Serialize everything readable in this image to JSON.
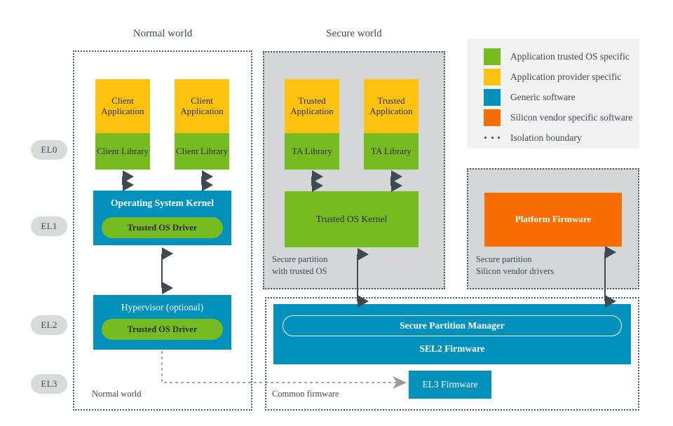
{
  "worlds": {
    "normal_title": "Normal world",
    "secure_title": "Secure world"
  },
  "exception_levels": [
    {
      "label": "EL0"
    },
    {
      "label": "EL1"
    },
    {
      "label": "EL2"
    },
    {
      "label": "EL3"
    }
  ],
  "normal_world": {
    "footer_label": "Normal world",
    "stacks": [
      {
        "app": "Client\nApplication",
        "lib": "Client\nLibrary"
      },
      {
        "app": "Client\nApplication",
        "lib": "Client\nLibrary"
      }
    ],
    "kernel": {
      "title": "Operating System Kernel",
      "driver": "Trusted OS Driver"
    },
    "hypervisor": {
      "title": "Hypervisor (optional)",
      "driver": "Trusted OS Driver"
    }
  },
  "secure_world": {
    "partition_caption": "Secure partition\nwith trusted OS",
    "stacks": [
      {
        "app": "Trusted\nApplication",
        "lib": "TA Library"
      },
      {
        "app": "Trusted\nApplication",
        "lib": "TA Library"
      }
    ],
    "kernel": "Trusted OS Kernel"
  },
  "vendor_partition": {
    "caption": "Secure partition\nSilicon vendor drivers",
    "firmware": "Platform Firmware"
  },
  "common_firmware": {
    "footer_label": "Common firmware",
    "spm": "Secure Partition Manager",
    "sel2": "SEL2 Firmware",
    "el3": "EL3 Firmware"
  },
  "legend": {
    "items": [
      {
        "type": "swatch",
        "color": "#76BC21",
        "label": "Application trusted OS specific"
      },
      {
        "type": "swatch",
        "color": "#FFC20E",
        "label": "Application provider specific"
      },
      {
        "type": "swatch",
        "color": "#0091BD",
        "label": "Generic software"
      },
      {
        "type": "swatch",
        "color": "#F96D00",
        "label": "Silicon vendor specific software"
      },
      {
        "type": "dots",
        "color": "#3d4a54",
        "label": "Isolation boundary"
      }
    ]
  },
  "colors": {
    "green": "#76BC21",
    "yellow": "#FFC20E",
    "blue": "#0091BD",
    "orange": "#F96D00",
    "gray_panel": "#d4d6d8",
    "legend_bg": "#F2F2F2",
    "boundary": "#4a5a64"
  }
}
